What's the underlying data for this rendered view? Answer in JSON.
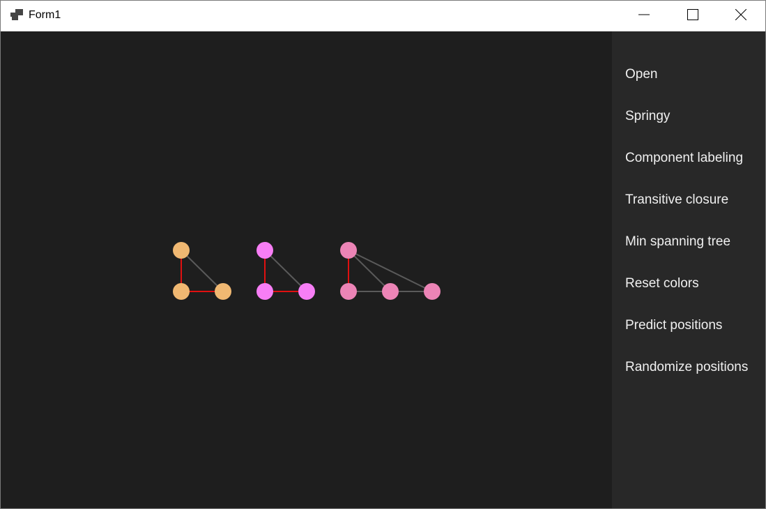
{
  "window": {
    "title": "Form1"
  },
  "titlebar": {
    "icons": [
      "app-icon",
      "minimize-icon",
      "maximize-icon",
      "close-icon"
    ]
  },
  "sidebar": {
    "items": [
      {
        "label": "Open"
      },
      {
        "label": "Springy"
      },
      {
        "label": "Component labeling"
      },
      {
        "label": "Transitive closure"
      },
      {
        "label": "Min spanning tree"
      },
      {
        "label": "Reset colors"
      },
      {
        "label": "Predict positions"
      },
      {
        "label": "Randomize positions"
      }
    ]
  },
  "graph": {
    "colors": {
      "background": "#1e1e1e",
      "highlight_edge": "#e01010",
      "normal_edge": "#5a5a5a"
    },
    "components": [
      {
        "color": "#f0b872",
        "nodes": [
          "a1",
          "a2",
          "a3"
        ],
        "edges": [
          {
            "from": "a1",
            "to": "a2",
            "highlight": true
          },
          {
            "from": "a2",
            "to": "a3",
            "highlight": true
          },
          {
            "from": "a1",
            "to": "a3",
            "highlight": false
          }
        ]
      },
      {
        "color": "#f77ef5",
        "nodes": [
          "b1",
          "b2",
          "b3"
        ],
        "edges": [
          {
            "from": "b1",
            "to": "b2",
            "highlight": true
          },
          {
            "from": "b2",
            "to": "b3",
            "highlight": true
          },
          {
            "from": "b1",
            "to": "b3",
            "highlight": false
          }
        ]
      },
      {
        "color": "#ec84b6",
        "nodes": [
          "c1",
          "c2",
          "c3",
          "c4"
        ],
        "edges": [
          {
            "from": "c1",
            "to": "c2",
            "highlight": true
          },
          {
            "from": "c2",
            "to": "c3",
            "highlight": false
          },
          {
            "from": "c3",
            "to": "c4",
            "highlight": false
          },
          {
            "from": "c1",
            "to": "c3",
            "highlight": false
          },
          {
            "from": "c1",
            "to": "c4",
            "highlight": false
          }
        ]
      }
    ]
  }
}
